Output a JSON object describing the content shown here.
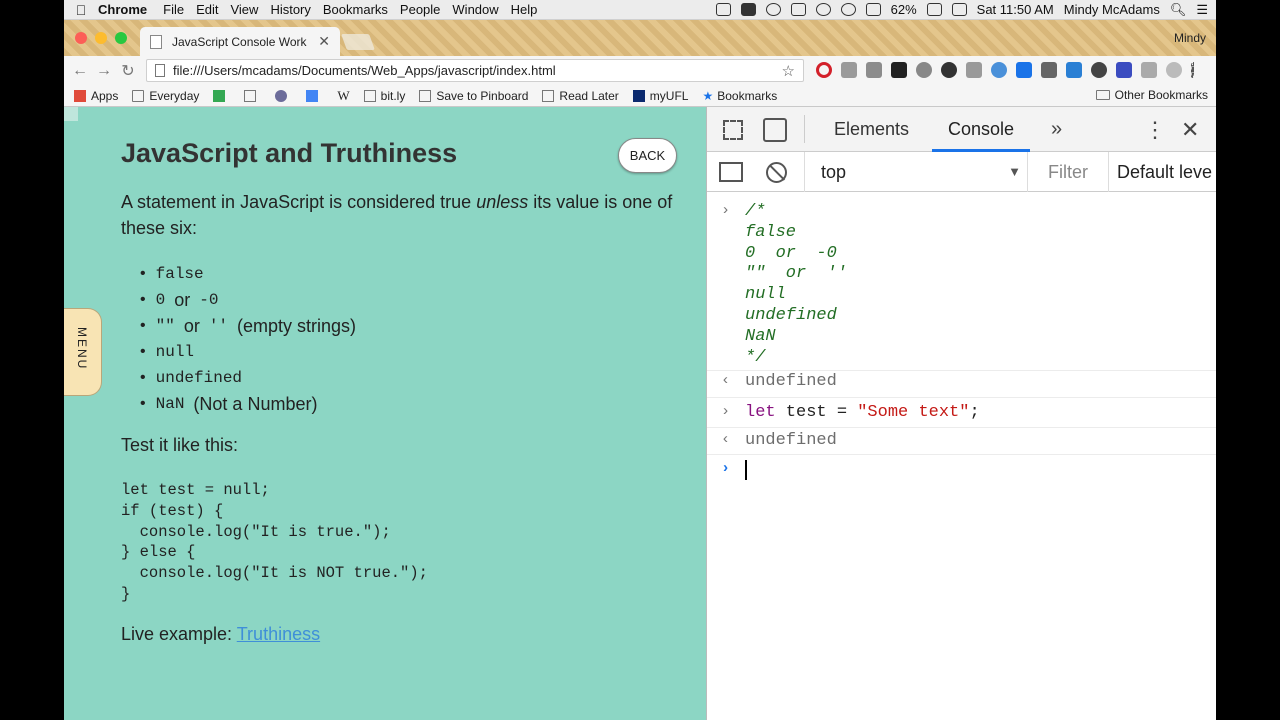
{
  "menubar": {
    "app": "Chrome",
    "menus": [
      "File",
      "Edit",
      "View",
      "History",
      "Bookmarks",
      "People",
      "Window",
      "Help"
    ],
    "battery": "62%",
    "clock": "Sat 11:50 AM",
    "user": "Mindy McAdams"
  },
  "tabs": {
    "active_title": "JavaScript Console Work",
    "profile": "Mindy"
  },
  "toolbar": {
    "url": "file:///Users/mcadams/Documents/Web_Apps/javascript/index.html"
  },
  "bookmarks": {
    "items": [
      "Apps",
      "Everyday",
      "",
      "",
      "",
      "W",
      "bit.ly",
      "Save to Pinboard",
      "Read Later",
      "myUFL",
      "Bookmarks"
    ],
    "other": "Other Bookmarks"
  },
  "page": {
    "title": "JavaScript and Truthiness",
    "back_label": "BACK",
    "menu_label": "MENU",
    "intro_before": "A statement in JavaScript is considered true ",
    "intro_em": "unless",
    "intro_after": " its value is one of these six:",
    "values": {
      "v1": "false",
      "v2a": "0",
      "v2or": "or",
      "v2b": "-0",
      "v3a": "\"\"",
      "v3or": "or",
      "v3b": "''",
      "v3note": "(empty strings)",
      "v4": "null",
      "v5": "undefined",
      "v6": "NaN",
      "v6note": "(Not a Number)"
    },
    "test_heading": "Test it like this:",
    "code": "let test = null;\nif (test) {\n  console.log(\"It is true.\");\n} else {\n  console.log(\"It is NOT true.\");\n}",
    "live_label": "Live example: ",
    "live_link": "Truthiness"
  },
  "devtools": {
    "tabs": [
      "Elements",
      "Console"
    ],
    "active_tab": "Console",
    "more": "»",
    "context": "top",
    "filter_placeholder": "Filter",
    "levels": "Default leve",
    "console": {
      "comment": "/*\nfalse\n0  or  -0\n\"\"  or  ''\nnull\nundefined\nNaN\n*/",
      "result1": "undefined",
      "input_kw": "let",
      "input_mid": " test = ",
      "input_str": "\"Some text\"",
      "input_end": ";",
      "result2": "undefined"
    }
  },
  "colors": {
    "page_bg": "#8cd6c4",
    "menu_tab_bg": "#f8e4b4",
    "link": "#3f8fd8",
    "comment": "#236e25",
    "keyword": "#881280",
    "string": "#c41a16",
    "accent": "#1a73e8"
  }
}
